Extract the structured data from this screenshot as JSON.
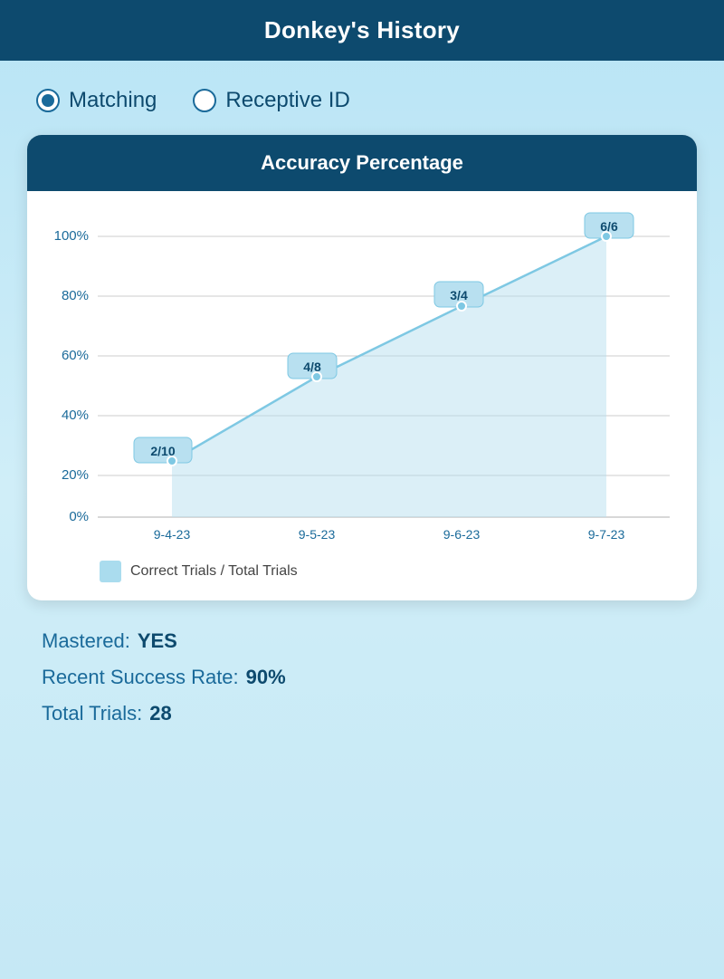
{
  "header": {
    "title": "Donkey's History"
  },
  "radio": {
    "options": [
      {
        "id": "matching",
        "label": "Matching",
        "selected": true
      },
      {
        "id": "receptive-id",
        "label": "Receptive ID",
        "selected": false
      }
    ]
  },
  "chart": {
    "title": "Accuracy Percentage",
    "y_labels": [
      "100%",
      "80%",
      "60%",
      "40%",
      "20%",
      "0%"
    ],
    "x_labels": [
      "9-4-23",
      "9-5-23",
      "9-6-23",
      "9-7-23"
    ],
    "data_points": [
      {
        "x_label": "9-4-23",
        "label": "2/10",
        "value": 20
      },
      {
        "x_label": "9-5-23",
        "label": "4/8",
        "value": 50
      },
      {
        "x_label": "9-6-23",
        "label": "3/4",
        "value": 75
      },
      {
        "x_label": "9-7-23",
        "label": "6/6",
        "value": 100
      }
    ],
    "legend_label": "Correct Trials / Total Trials"
  },
  "stats": {
    "mastered_label": "Mastered:",
    "mastered_value": "YES",
    "success_rate_label": "Recent Success Rate:",
    "success_rate_value": "90%",
    "total_trials_label": "Total Trials:",
    "total_trials_value": "28"
  }
}
